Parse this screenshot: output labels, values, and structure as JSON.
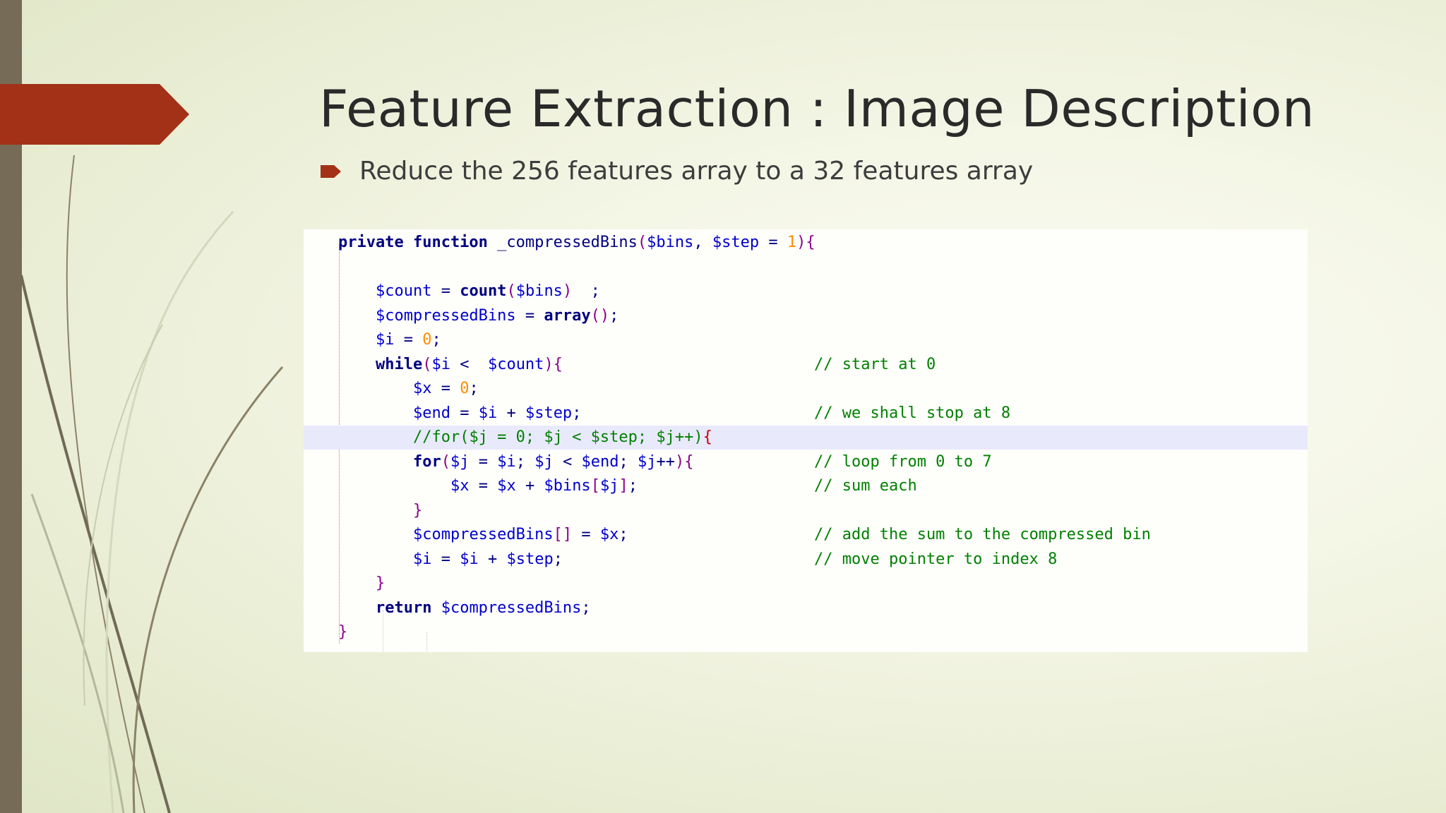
{
  "slide": {
    "title": "Feature Extraction :  Image Description",
    "bullet": "Reduce the 256 features array to a 32 features array"
  },
  "colors": {
    "accent": "#a33117",
    "left_bar": "#766b57",
    "title_text": "#2a2a2a",
    "keyword": "#000080",
    "variable": "#0000cd",
    "number": "#ff8c00",
    "comment": "#008000",
    "line_highlight": "#e9e9fc"
  },
  "code": {
    "highlighted_line": 8,
    "lines": [
      {
        "tokens": [
          {
            "t": "private function ",
            "c": "kw"
          },
          {
            "t": "_compressedBins",
            "c": "op"
          },
          {
            "t": "(",
            "c": "br"
          },
          {
            "t": "$bins",
            "c": "var"
          },
          {
            "t": ", ",
            "c": "op"
          },
          {
            "t": "$step",
            "c": "var"
          },
          {
            "t": " = ",
            "c": "op"
          },
          {
            "t": "1",
            "c": "num"
          },
          {
            "t": "){",
            "c": "br"
          }
        ],
        "comment": ""
      },
      {
        "tokens": [],
        "comment": ""
      },
      {
        "tokens": [
          {
            "t": "    ",
            "c": "op"
          },
          {
            "t": "$count",
            "c": "var"
          },
          {
            "t": " = ",
            "c": "op"
          },
          {
            "t": "count",
            "c": "kw"
          },
          {
            "t": "(",
            "c": "br"
          },
          {
            "t": "$bins",
            "c": "var"
          },
          {
            "t": ") ",
            "c": "br"
          },
          {
            "t": " ;",
            "c": "op"
          }
        ],
        "comment": ""
      },
      {
        "tokens": [
          {
            "t": "    ",
            "c": "op"
          },
          {
            "t": "$compressedBins",
            "c": "var"
          },
          {
            "t": " = ",
            "c": "op"
          },
          {
            "t": "array",
            "c": "kw"
          },
          {
            "t": "()",
            "c": "br"
          },
          {
            "t": ";",
            "c": "op"
          }
        ],
        "comment": ""
      },
      {
        "tokens": [
          {
            "t": "    ",
            "c": "op"
          },
          {
            "t": "$i",
            "c": "var"
          },
          {
            "t": " = ",
            "c": "op"
          },
          {
            "t": "0",
            "c": "num"
          },
          {
            "t": ";",
            "c": "op"
          }
        ],
        "comment": ""
      },
      {
        "tokens": [
          {
            "t": "    ",
            "c": "op"
          },
          {
            "t": "while",
            "c": "kw"
          },
          {
            "t": "(",
            "c": "br"
          },
          {
            "t": "$i",
            "c": "var"
          },
          {
            "t": " <  ",
            "c": "op"
          },
          {
            "t": "$count",
            "c": "var"
          },
          {
            "t": "){",
            "c": "br"
          }
        ],
        "comment": "// start at 0"
      },
      {
        "tokens": [
          {
            "t": "        ",
            "c": "op"
          },
          {
            "t": "$x",
            "c": "var"
          },
          {
            "t": " = ",
            "c": "op"
          },
          {
            "t": "0",
            "c": "num"
          },
          {
            "t": ";",
            "c": "op"
          }
        ],
        "comment": ""
      },
      {
        "tokens": [
          {
            "t": "        ",
            "c": "op"
          },
          {
            "t": "$end",
            "c": "var"
          },
          {
            "t": " = ",
            "c": "op"
          },
          {
            "t": "$i",
            "c": "var"
          },
          {
            "t": " + ",
            "c": "op"
          },
          {
            "t": "$step",
            "c": "var"
          },
          {
            "t": ";",
            "c": "op"
          }
        ],
        "comment": "// we shall stop at 8"
      },
      {
        "tokens": [
          {
            "t": "        ",
            "c": "op"
          },
          {
            "t": "//for($j = 0; $j < $step; $j++)",
            "c": "cm"
          },
          {
            "t": "{",
            "c": "cursor"
          }
        ],
        "comment": ""
      },
      {
        "tokens": [
          {
            "t": "        ",
            "c": "op"
          },
          {
            "t": "for",
            "c": "kw"
          },
          {
            "t": "(",
            "c": "br"
          },
          {
            "t": "$j",
            "c": "var"
          },
          {
            "t": " = ",
            "c": "op"
          },
          {
            "t": "$i",
            "c": "var"
          },
          {
            "t": "; ",
            "c": "op"
          },
          {
            "t": "$j",
            "c": "var"
          },
          {
            "t": " < ",
            "c": "op"
          },
          {
            "t": "$end",
            "c": "var"
          },
          {
            "t": "; ",
            "c": "op"
          },
          {
            "t": "$j",
            "c": "var"
          },
          {
            "t": "++",
            "c": "op"
          },
          {
            "t": "){",
            "c": "br"
          }
        ],
        "comment": "// loop from 0 to 7"
      },
      {
        "tokens": [
          {
            "t": "            ",
            "c": "op"
          },
          {
            "t": "$x",
            "c": "var"
          },
          {
            "t": " = ",
            "c": "op"
          },
          {
            "t": "$x",
            "c": "var"
          },
          {
            "t": " + ",
            "c": "op"
          },
          {
            "t": "$bins",
            "c": "var"
          },
          {
            "t": "[",
            "c": "br"
          },
          {
            "t": "$j",
            "c": "var"
          },
          {
            "t": "]",
            "c": "br"
          },
          {
            "t": ";",
            "c": "op"
          }
        ],
        "comment": "// sum each"
      },
      {
        "tokens": [
          {
            "t": "        ",
            "c": "op"
          },
          {
            "t": "}",
            "c": "br"
          }
        ],
        "comment": ""
      },
      {
        "tokens": [
          {
            "t": "        ",
            "c": "op"
          },
          {
            "t": "$compressedBins",
            "c": "var"
          },
          {
            "t": "[]",
            "c": "br"
          },
          {
            "t": " = ",
            "c": "op"
          },
          {
            "t": "$x",
            "c": "var"
          },
          {
            "t": ";",
            "c": "op"
          }
        ],
        "comment": "// add the sum to the compressed bin"
      },
      {
        "tokens": [
          {
            "t": "        ",
            "c": "op"
          },
          {
            "t": "$i",
            "c": "var"
          },
          {
            "t": " = ",
            "c": "op"
          },
          {
            "t": "$i",
            "c": "var"
          },
          {
            "t": " + ",
            "c": "op"
          },
          {
            "t": "$step",
            "c": "var"
          },
          {
            "t": ";",
            "c": "op"
          }
        ],
        "comment": "// move pointer to index 8"
      },
      {
        "tokens": [
          {
            "t": "    ",
            "c": "op"
          },
          {
            "t": "}",
            "c": "br"
          }
        ],
        "comment": ""
      },
      {
        "tokens": [
          {
            "t": "    ",
            "c": "op"
          },
          {
            "t": "return ",
            "c": "kw"
          },
          {
            "t": "$compressedBins",
            "c": "var"
          },
          {
            "t": ";",
            "c": "op"
          }
        ],
        "comment": ""
      },
      {
        "tokens": [
          {
            "t": "}",
            "c": "br"
          }
        ],
        "comment": ""
      }
    ]
  }
}
